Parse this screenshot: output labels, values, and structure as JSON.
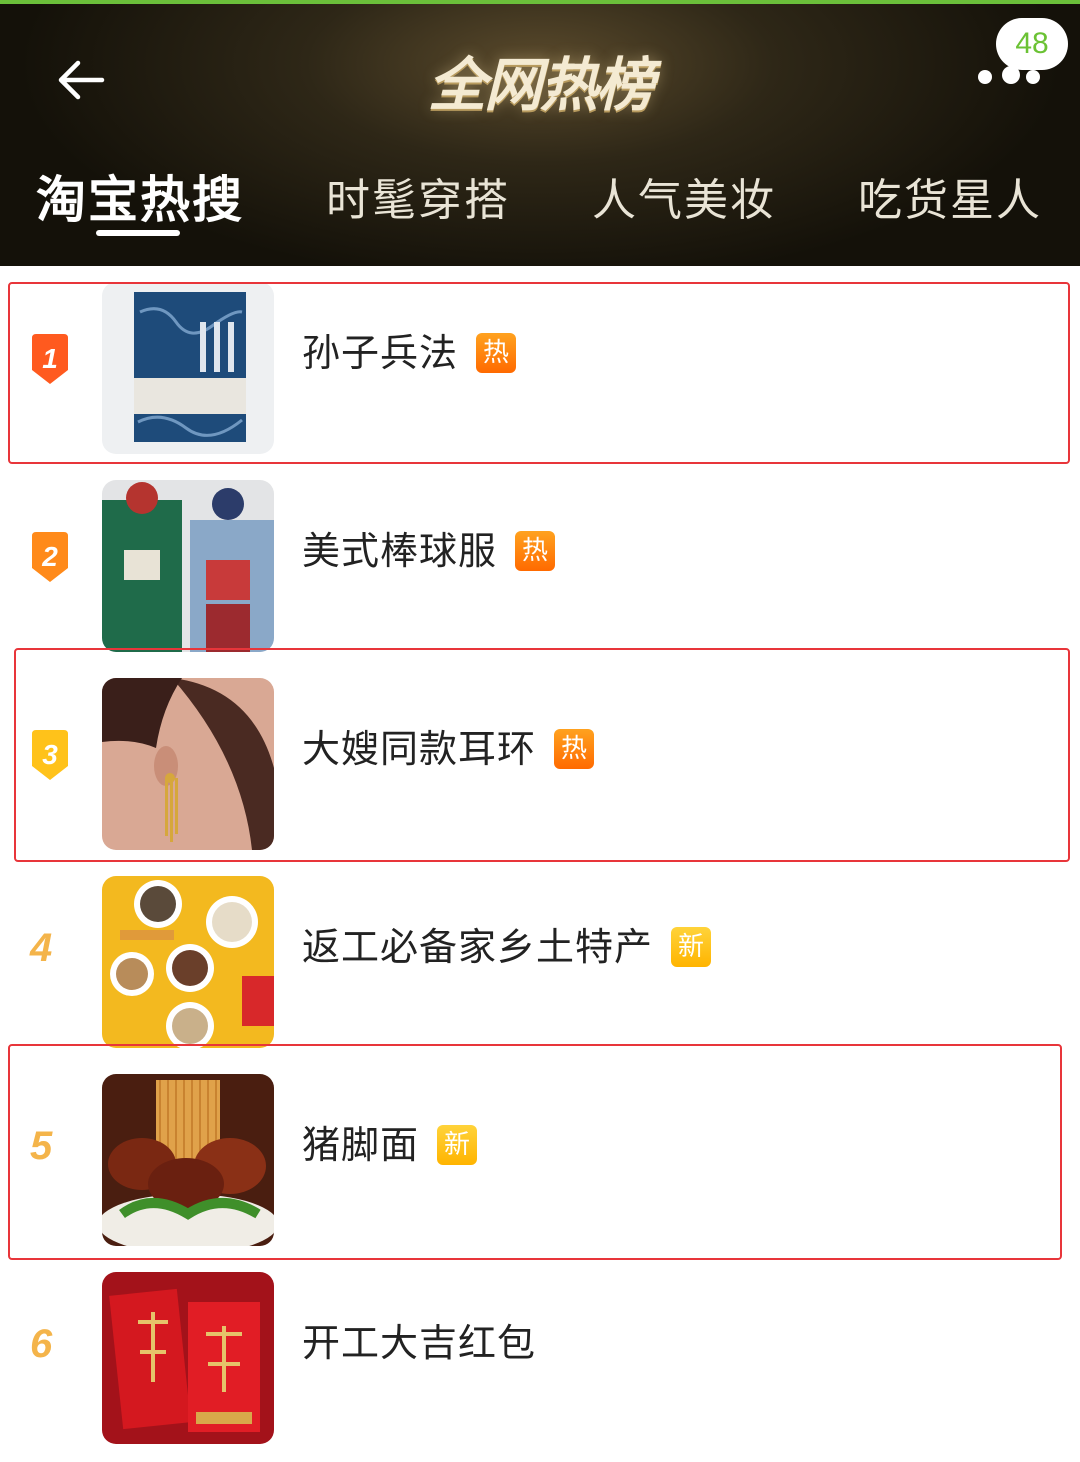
{
  "header": {
    "title": "全网热榜",
    "badge_count": "48",
    "tabs": [
      {
        "label": "淘宝热搜",
        "active": true
      },
      {
        "label": "时髦穿搭",
        "active": false
      },
      {
        "label": "人气美妆",
        "active": false
      },
      {
        "label": "吃货星人",
        "active": false
      }
    ]
  },
  "colors": {
    "hot_tag": "#ff7a00",
    "new_tag": "#ffc21a",
    "rank_top": "#ff5a1f",
    "rank_other": "#f4b44a",
    "highlight_border": "#e8353a"
  },
  "items": [
    {
      "rank": "1",
      "text": "孙子兵法",
      "tag": "热",
      "tag_type": "hot",
      "image": "book-cover",
      "highlighted": true
    },
    {
      "rank": "2",
      "text": "美式棒球服",
      "tag": "热",
      "tag_type": "hot",
      "image": "baseball-jacket-photo",
      "highlighted": false
    },
    {
      "rank": "3",
      "text": "大嫂同款耳环",
      "tag": "热",
      "tag_type": "hot",
      "image": "earring-photo",
      "highlighted": true
    },
    {
      "rank": "4",
      "text": "返工必备家乡土特产",
      "tag": "新",
      "tag_type": "new",
      "image": "local-specialty-photo",
      "highlighted": false
    },
    {
      "rank": "5",
      "text": "猪脚面",
      "tag": "新",
      "tag_type": "new",
      "image": "pork-knuckle-noodles-photo",
      "highlighted": true
    },
    {
      "rank": "6",
      "text": "开工大吉红包",
      "tag": "",
      "tag_type": "none",
      "image": "red-envelope-photo",
      "highlighted": false
    }
  ]
}
